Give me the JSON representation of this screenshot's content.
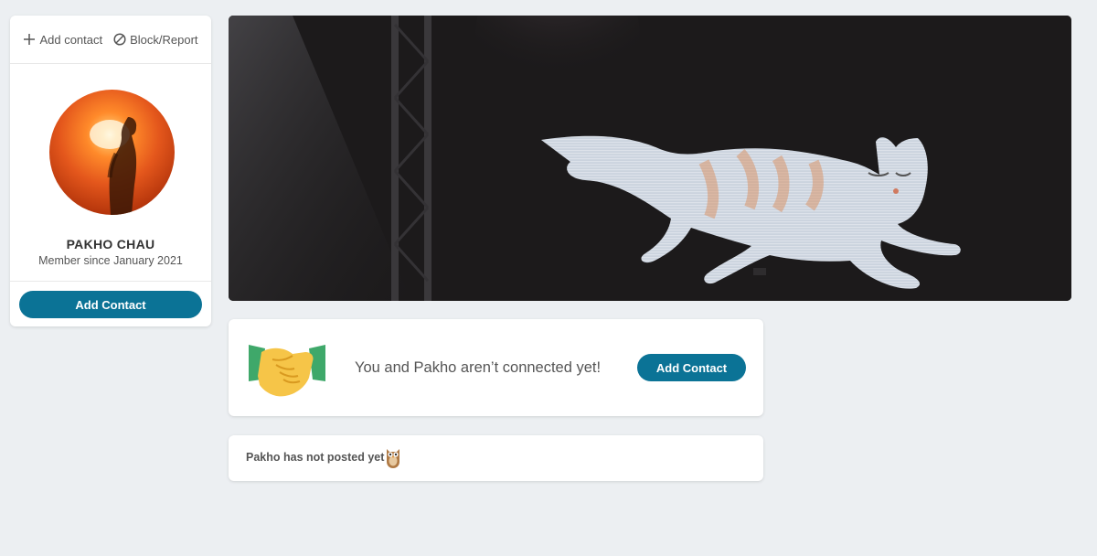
{
  "profile": {
    "add_contact_action": "Add contact",
    "block_report_action": "Block/Report",
    "name": "PAKHO CHAU",
    "member_since": "Member since January 2021",
    "add_contact_button": "Add Contact"
  },
  "connect": {
    "message": "You and Pakho aren’t connected yet!",
    "add_contact_button": "Add Contact"
  },
  "posts": {
    "empty_message": "Pakho has not posted yet"
  },
  "icons": {
    "add": "plus-icon",
    "block": "block-icon",
    "connect": "handshake-icon",
    "posts": "owl-icon"
  },
  "colors": {
    "accent": "#0b7396",
    "page_background": "#eceff2"
  }
}
